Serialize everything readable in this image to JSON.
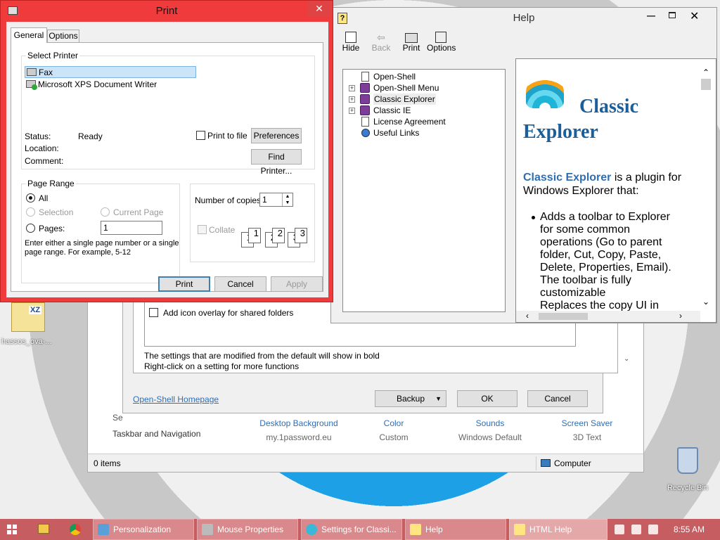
{
  "colors": {
    "print_frame": "#ef3b3b",
    "taskbar": "#c55d61",
    "help_heading": "#1a5e9c",
    "link": "#2e6eb5"
  },
  "print_dialog": {
    "title": "Print",
    "tabs": [
      "General",
      "Options"
    ],
    "select_printer_label": "Select Printer",
    "printers": [
      "Fax",
      "Microsoft XPS Document Writer"
    ],
    "status_label": "Status:",
    "status_value": "Ready",
    "location_label": "Location:",
    "comment_label": "Comment:",
    "print_to_file": "Print to file",
    "preferences": "Preferences",
    "find_printer": "Find Printer...",
    "page_range_label": "Page Range",
    "all": "All",
    "selection": "Selection",
    "current_page": "Current Page",
    "pages": "Pages:",
    "pages_value": "1",
    "help_text_1": "Enter either a single page number or a single",
    "help_text_2": "page range.  For example, 5-12",
    "copies_label": "Number of copies:",
    "copies_value": "1",
    "collate": "Collate",
    "collate_pages": [
      "1",
      "1",
      "2",
      "2",
      "3",
      "3"
    ],
    "print_btn": "Print",
    "cancel_btn": "Cancel",
    "apply_btn": "Apply"
  },
  "help_window": {
    "title": "Help",
    "toolbar": [
      "Hide",
      "Back",
      "Print",
      "Options"
    ],
    "tree": [
      "Open-Shell",
      "Open-Shell Menu",
      "Classic Explorer",
      "Classic IE",
      "License Agreement",
      "Useful Links"
    ],
    "heading_1": "Classic",
    "heading_2": "Explorer",
    "intro_link": "Classic Explorer",
    "intro_rest_1": " is a plugin for",
    "intro_rest_2": "Windows Explorer that:",
    "bullet_lines": [
      "Adds a toolbar to Explorer",
      "for some common",
      "operations (Go to parent",
      "folder, Cut, Copy, Paste,",
      "Delete, Properties, Email).",
      "The toolbar is fully",
      "customizable",
      "Replaces the copy UI in"
    ]
  },
  "settings_window": {
    "checkbox_label": "Add icon overlay for shared folders",
    "note_1": "The settings that are modified from the default will show in bold",
    "note_2": "Right-click on a setting for more functions",
    "homepage_link": "Open-Shell Homepage",
    "backup_btn": "Backup",
    "ok_btn": "OK",
    "cancel_btn": "Cancel"
  },
  "explorer_window": {
    "left_label_partial": "Se",
    "left_item": "Taskbar and Navigation",
    "items": [
      {
        "title": "Desktop Background",
        "sub": "my.1password.eu"
      },
      {
        "title": "Color",
        "sub": "Custom"
      },
      {
        "title": "Sounds",
        "sub": "Windows Default"
      },
      {
        "title": "Screen Saver",
        "sub": "3D Text"
      }
    ],
    "status_items": "0 items",
    "status_location": "Computer"
  },
  "desktop": {
    "file_icon_label": "hassos_ova-...",
    "file_icon_badge": "XZ",
    "recycle_bin": "Recycle Bin"
  },
  "taskbar": {
    "items": [
      "Personalization",
      "Mouse Properties",
      "Settings for Classi...",
      "Help",
      "HTML Help"
    ],
    "clock": "8:55 AM"
  }
}
